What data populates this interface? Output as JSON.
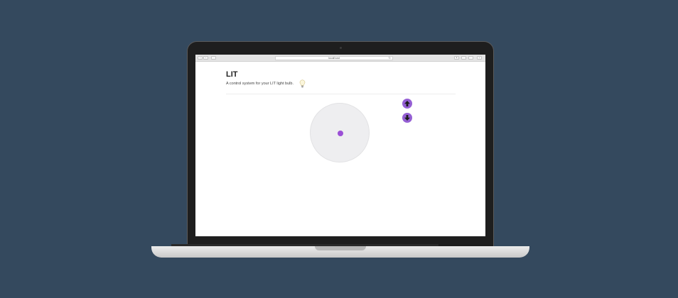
{
  "browser": {
    "url": "localhost"
  },
  "app": {
    "title": "LIT",
    "subtitle": "A control system for your LIT light bulb.",
    "colors": {
      "accent": "#9560d4",
      "dot": "#9b4fd6",
      "wheel": "#eeeef0",
      "background": "#34495e"
    }
  },
  "controls": {
    "up_icon": "arrow-up-icon",
    "down_icon": "arrow-down-icon"
  }
}
